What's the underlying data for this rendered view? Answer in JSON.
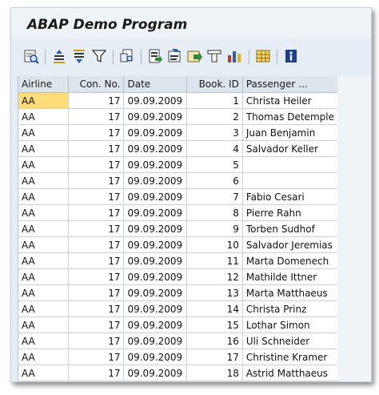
{
  "window": {
    "title": "ABAP Demo Program"
  },
  "toolbar": {
    "buttons": [
      {
        "icon": "details-icon"
      },
      {
        "icon": "sort-ascending-icon"
      },
      {
        "icon": "sort-descending-icon"
      },
      {
        "icon": "filter-icon"
      },
      {
        "icon": "print-preview-icon"
      },
      {
        "icon": "export-icon"
      },
      {
        "icon": "word-processing-icon"
      },
      {
        "icon": "local-file-icon"
      },
      {
        "icon": "layout-icon"
      },
      {
        "icon": "graphic-icon"
      },
      {
        "icon": "grid-layout-icon"
      },
      {
        "icon": "info-icon"
      }
    ]
  },
  "grid": {
    "columns": [
      "Airline",
      "Con. No.",
      "Date",
      "Book. ID",
      "Passenger ..."
    ],
    "rows": [
      [
        "AA",
        "17",
        "09.09.2009",
        "1",
        "Christa Heiler"
      ],
      [
        "AA",
        "17",
        "09.09.2009",
        "2",
        "Thomas Detemple"
      ],
      [
        "AA",
        "17",
        "09.09.2009",
        "3",
        "Juan Benjamin"
      ],
      [
        "AA",
        "17",
        "09.09.2009",
        "4",
        "Salvador Keller"
      ],
      [
        "AA",
        "17",
        "09.09.2009",
        "5",
        ""
      ],
      [
        "AA",
        "17",
        "09.09.2009",
        "6",
        ""
      ],
      [
        "AA",
        "17",
        "09.09.2009",
        "7",
        "Fabio Cesari"
      ],
      [
        "AA",
        "17",
        "09.09.2009",
        "8",
        "Pierre Rahn"
      ],
      [
        "AA",
        "17",
        "09.09.2009",
        "9",
        "Torben Sudhof"
      ],
      [
        "AA",
        "17",
        "09.09.2009",
        "10",
        "Salvador Jeremias"
      ],
      [
        "AA",
        "17",
        "09.09.2009",
        "11",
        "Marta Domenech"
      ],
      [
        "AA",
        "17",
        "09.09.2009",
        "12",
        "Mathilde Ittner"
      ],
      [
        "AA",
        "17",
        "09.09.2009",
        "13",
        "Marta Matthaeus"
      ],
      [
        "AA",
        "17",
        "09.09.2009",
        "14",
        "Christa Prinz"
      ],
      [
        "AA",
        "17",
        "09.09.2009",
        "15",
        "Lothar Simon"
      ],
      [
        "AA",
        "17",
        "09.09.2009",
        "16",
        "Uli Schneider"
      ],
      [
        "AA",
        "17",
        "09.09.2009",
        "17",
        "Christine Kramer"
      ],
      [
        "AA",
        "17",
        "09.09.2009",
        "18",
        "Astrid Matthaeus"
      ]
    ]
  },
  "colors": {
    "selected_cell": "#fddc7a",
    "header_bg": "#dce4ec",
    "window_bg": "#e6edf4"
  }
}
